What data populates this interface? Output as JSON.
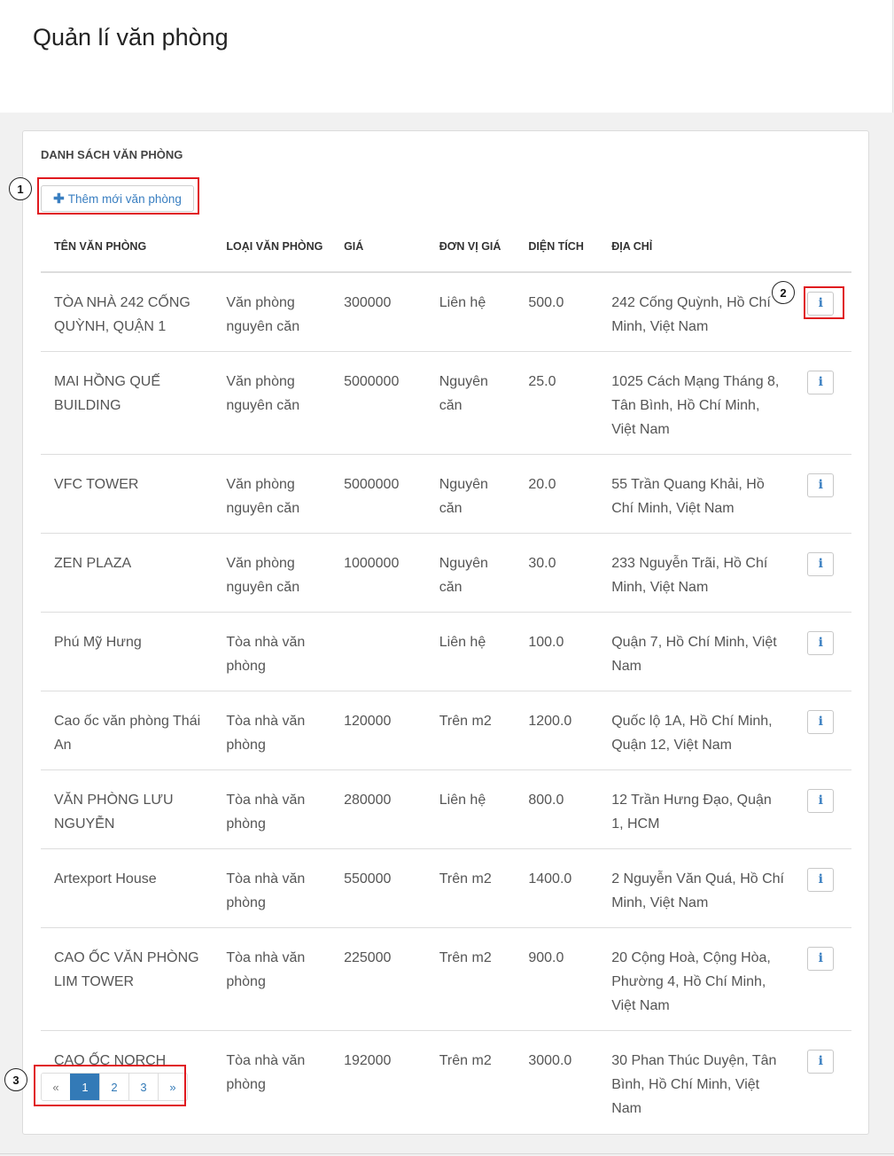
{
  "page": {
    "title": "Quản lí văn phòng"
  },
  "panel": {
    "heading": "DANH SÁCH VĂN PHÒNG",
    "add_button_label": "Thêm mới văn phòng"
  },
  "table": {
    "headers": {
      "name": "TÊN VĂN PHÒNG",
      "type": "LOẠI VĂN PHÒNG",
      "price": "GIÁ",
      "unit": "ĐƠN VỊ GIÁ",
      "area": "DIỆN TÍCH",
      "address": "ĐỊA CHỈ"
    },
    "rows": [
      {
        "name": "TÒA NHÀ 242 CỐNG QUỲNH, QUẬN 1",
        "type": "Văn phòng nguyên căn",
        "price": "300000",
        "unit": "Liên hệ",
        "area": "500.0",
        "address": "242 Cống Quỳnh, Hồ Chí Minh, Việt Nam"
      },
      {
        "name": "MAI HỒNG QUẾ BUILDING",
        "type": "Văn phòng nguyên căn",
        "price": "5000000",
        "unit": "Nguyên căn",
        "area": "25.0",
        "address": "1025 Cách Mạng Tháng 8, Tân Bình, Hồ Chí Minh, Việt Nam"
      },
      {
        "name": "VFC TOWER",
        "type": "Văn phòng nguyên căn",
        "price": "5000000",
        "unit": "Nguyên căn",
        "area": "20.0",
        "address": "55 Trần Quang Khải, Hồ Chí Minh, Việt Nam"
      },
      {
        "name": "ZEN PLAZA",
        "type": "Văn phòng nguyên căn",
        "price": "1000000",
        "unit": "Nguyên căn",
        "area": "30.0",
        "address": "233 Nguyễn Trãi, Hồ Chí Minh, Việt Nam"
      },
      {
        "name": "Phú Mỹ Hưng",
        "type": "Tòa nhà văn phòng",
        "price": "",
        "unit": "Liên hệ",
        "area": "100.0",
        "address": "Quận 7, Hồ Chí Minh, Việt Nam"
      },
      {
        "name": "Cao ốc văn phòng Thái An",
        "type": "Tòa nhà văn phòng",
        "price": "120000",
        "unit": "Trên m2",
        "area": "1200.0",
        "address": "Quốc lộ 1A, Hồ Chí Minh, Quận 12, Việt Nam"
      },
      {
        "name": "VĂN PHÒNG LƯU NGUYỄN",
        "type": "Tòa nhà văn phòng",
        "price": "280000",
        "unit": "Liên hệ",
        "area": "800.0",
        "address": "12 Trần Hưng Đạo, Quận 1, HCM"
      },
      {
        "name": "Artexport House",
        "type": "Tòa nhà văn phòng",
        "price": "550000",
        "unit": "Trên m2",
        "area": "1400.0",
        "address": "2 Nguyễn Văn Quá, Hồ Chí Minh, Việt Nam"
      },
      {
        "name": "CAO ỐC VĂN PHÒNG LIM TOWER",
        "type": "Tòa nhà văn phòng",
        "price": "225000",
        "unit": "Trên m2",
        "area": "900.0",
        "address": "20 Cộng Hoà, Cộng Hòa, Phường 4, Hồ Chí Minh, Việt Nam"
      },
      {
        "name": "CAO ỐC NORCH BUILDING",
        "type": "Tòa nhà văn phòng",
        "price": "192000",
        "unit": "Trên m2",
        "area": "3000.0",
        "address": "30 Phan Thúc Duyện, Tân Bình, Hồ Chí Minh, Việt Nam"
      }
    ],
    "info_icon": "info-icon"
  },
  "pagination": {
    "prev": "«",
    "pages": [
      "1",
      "2",
      "3"
    ],
    "active": "1",
    "next": "»"
  },
  "annotations": {
    "callouts": [
      "1",
      "2",
      "3"
    ],
    "highlight_color": "#e0191f"
  },
  "colors": {
    "link": "#337ab7",
    "active_page_bg": "#337ab7"
  }
}
